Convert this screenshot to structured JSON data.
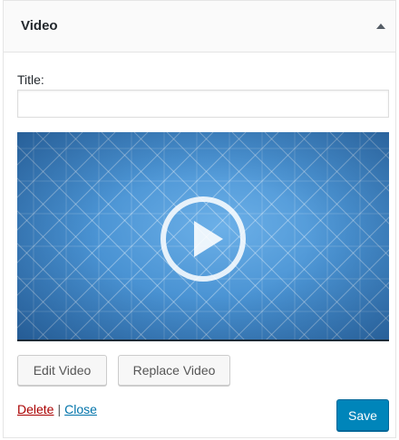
{
  "widget": {
    "title": "Video",
    "toggle_icon": "triangle-up-icon"
  },
  "form": {
    "title_label": "Title:",
    "title_value": "",
    "title_placeholder": ""
  },
  "video": {
    "play_icon": "play-icon",
    "background_color": "#4a93d3"
  },
  "actions": {
    "edit_label": "Edit Video",
    "replace_label": "Replace Video",
    "delete_label": "Delete",
    "separator": "|",
    "close_label": "Close",
    "save_label": "Save"
  },
  "colors": {
    "save_button": "#0085ba",
    "delete_link": "#aa0000",
    "close_link": "#0073aa"
  }
}
